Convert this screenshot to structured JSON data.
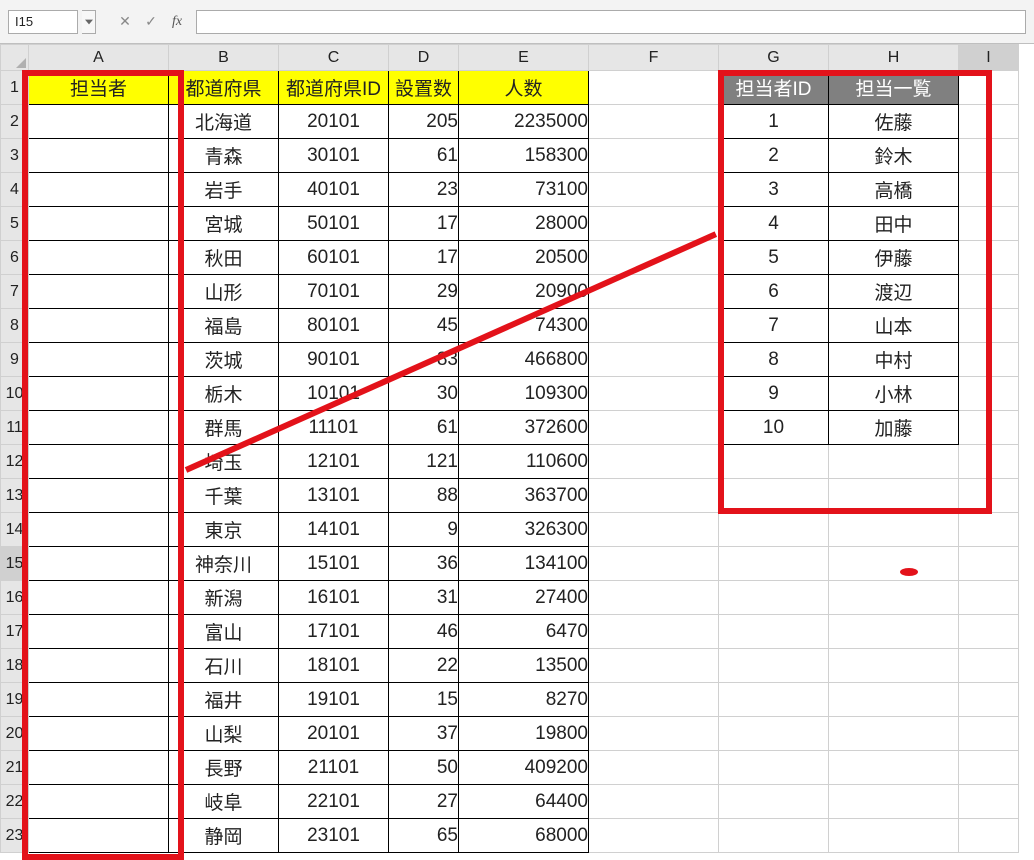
{
  "name_box": "I15",
  "col_letters": [
    "A",
    "B",
    "C",
    "D",
    "E",
    "F",
    "G",
    "H",
    "I"
  ],
  "row_numbers": [
    1,
    2,
    3,
    4,
    5,
    6,
    7,
    8,
    9,
    10,
    11,
    12,
    13,
    14,
    15,
    16,
    17,
    18,
    19,
    20,
    21,
    22,
    23
  ],
  "main_headers": [
    "担当者",
    "都道府県",
    "都道府県ID",
    "設置数",
    "人数"
  ],
  "main_rows": [
    {
      "pref": "北海道",
      "id": "20101",
      "cnt": "205",
      "pop": "2235000"
    },
    {
      "pref": "青森",
      "id": "30101",
      "cnt": "61",
      "pop": "158300"
    },
    {
      "pref": "岩手",
      "id": "40101",
      "cnt": "23",
      "pop": "73100"
    },
    {
      "pref": "宮城",
      "id": "50101",
      "cnt": "17",
      "pop": "28000"
    },
    {
      "pref": "秋田",
      "id": "60101",
      "cnt": "17",
      "pop": "20500"
    },
    {
      "pref": "山形",
      "id": "70101",
      "cnt": "29",
      "pop": "20900"
    },
    {
      "pref": "福島",
      "id": "80101",
      "cnt": "45",
      "pop": "74300"
    },
    {
      "pref": "茨城",
      "id": "90101",
      "cnt": "83",
      "pop": "466800"
    },
    {
      "pref": "栃木",
      "id": "10101",
      "cnt": "30",
      "pop": "109300"
    },
    {
      "pref": "群馬",
      "id": "11101",
      "cnt": "61",
      "pop": "372600"
    },
    {
      "pref": "埼玉",
      "id": "12101",
      "cnt": "121",
      "pop": "110600"
    },
    {
      "pref": "千葉",
      "id": "13101",
      "cnt": "88",
      "pop": "363700"
    },
    {
      "pref": "東京",
      "id": "14101",
      "cnt": "9",
      "pop": "326300"
    },
    {
      "pref": "神奈川",
      "id": "15101",
      "cnt": "36",
      "pop": "134100"
    },
    {
      "pref": "新潟",
      "id": "16101",
      "cnt": "31",
      "pop": "27400"
    },
    {
      "pref": "富山",
      "id": "17101",
      "cnt": "46",
      "pop": "6470"
    },
    {
      "pref": "石川",
      "id": "18101",
      "cnt": "22",
      "pop": "13500"
    },
    {
      "pref": "福井",
      "id": "19101",
      "cnt": "15",
      "pop": "8270"
    },
    {
      "pref": "山梨",
      "id": "20101",
      "cnt": "37",
      "pop": "19800"
    },
    {
      "pref": "長野",
      "id": "21101",
      "cnt": "50",
      "pop": "409200"
    },
    {
      "pref": "岐阜",
      "id": "22101",
      "cnt": "27",
      "pop": "64400"
    },
    {
      "pref": "静岡",
      "id": "23101",
      "cnt": "65",
      "pop": "68000"
    }
  ],
  "lookup_headers": [
    "担当者ID",
    "担当一覧"
  ],
  "lookup_rows": [
    {
      "id": "1",
      "name": "佐藤"
    },
    {
      "id": "2",
      "name": "鈴木"
    },
    {
      "id": "3",
      "name": "高橋"
    },
    {
      "id": "4",
      "name": "田中"
    },
    {
      "id": "5",
      "name": "伊藤"
    },
    {
      "id": "6",
      "name": "渡辺"
    },
    {
      "id": "7",
      "name": "山本"
    },
    {
      "id": "8",
      "name": "中村"
    },
    {
      "id": "9",
      "name": "小林"
    },
    {
      "id": "10",
      "name": "加藤"
    }
  ]
}
